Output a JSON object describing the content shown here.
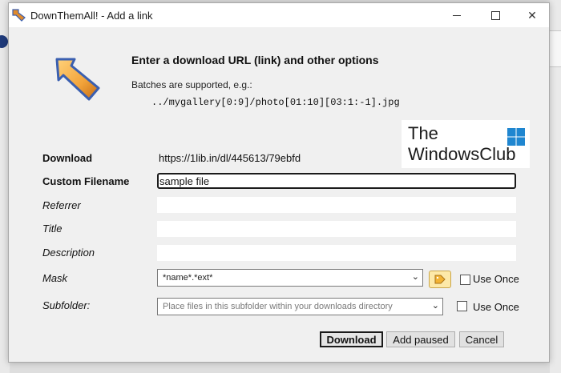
{
  "window": {
    "title": "DownThemAll! - Add a link",
    "minimize_icon": "minimize-icon",
    "maximize_icon": "maximize-icon",
    "close_icon": "close-icon"
  },
  "header": {
    "title": "Enter a download URL (link) and other options",
    "note": "Batches are supported, e.g.:",
    "example": "../mygallery[0:9]/photo[01:10][03:1:-1].jpg"
  },
  "watermark": {
    "line1": "The",
    "line2": "WindowsClub"
  },
  "form": {
    "download_label": "Download",
    "download_value": "https://1lib.in/dl/445613/79ebfd",
    "custom_filename_label": "Custom Filename",
    "custom_filename_value": "sample file",
    "referrer_label": "Referrer",
    "referrer_value": "",
    "title_label": "Title",
    "title_value": "",
    "description_label": "Description",
    "description_value": "",
    "mask_label": "Mask",
    "mask_value": "*name*.*ext*",
    "mask_use_once_label": "Use Once",
    "subfolder_label": "Subfolder:",
    "subfolder_placeholder": "Place files in this subfolder within your downloads directory",
    "subfolder_use_once_label": "Use Once"
  },
  "buttons": {
    "download": "Download",
    "add_paused": "Add paused",
    "cancel": "Cancel"
  },
  "colors": {
    "dialog_bg": "#f0f0f0",
    "arrow_orange": "#f2a33a",
    "arrow_blue": "#3a5fb0",
    "tag_yellow": "#fde9a8"
  }
}
